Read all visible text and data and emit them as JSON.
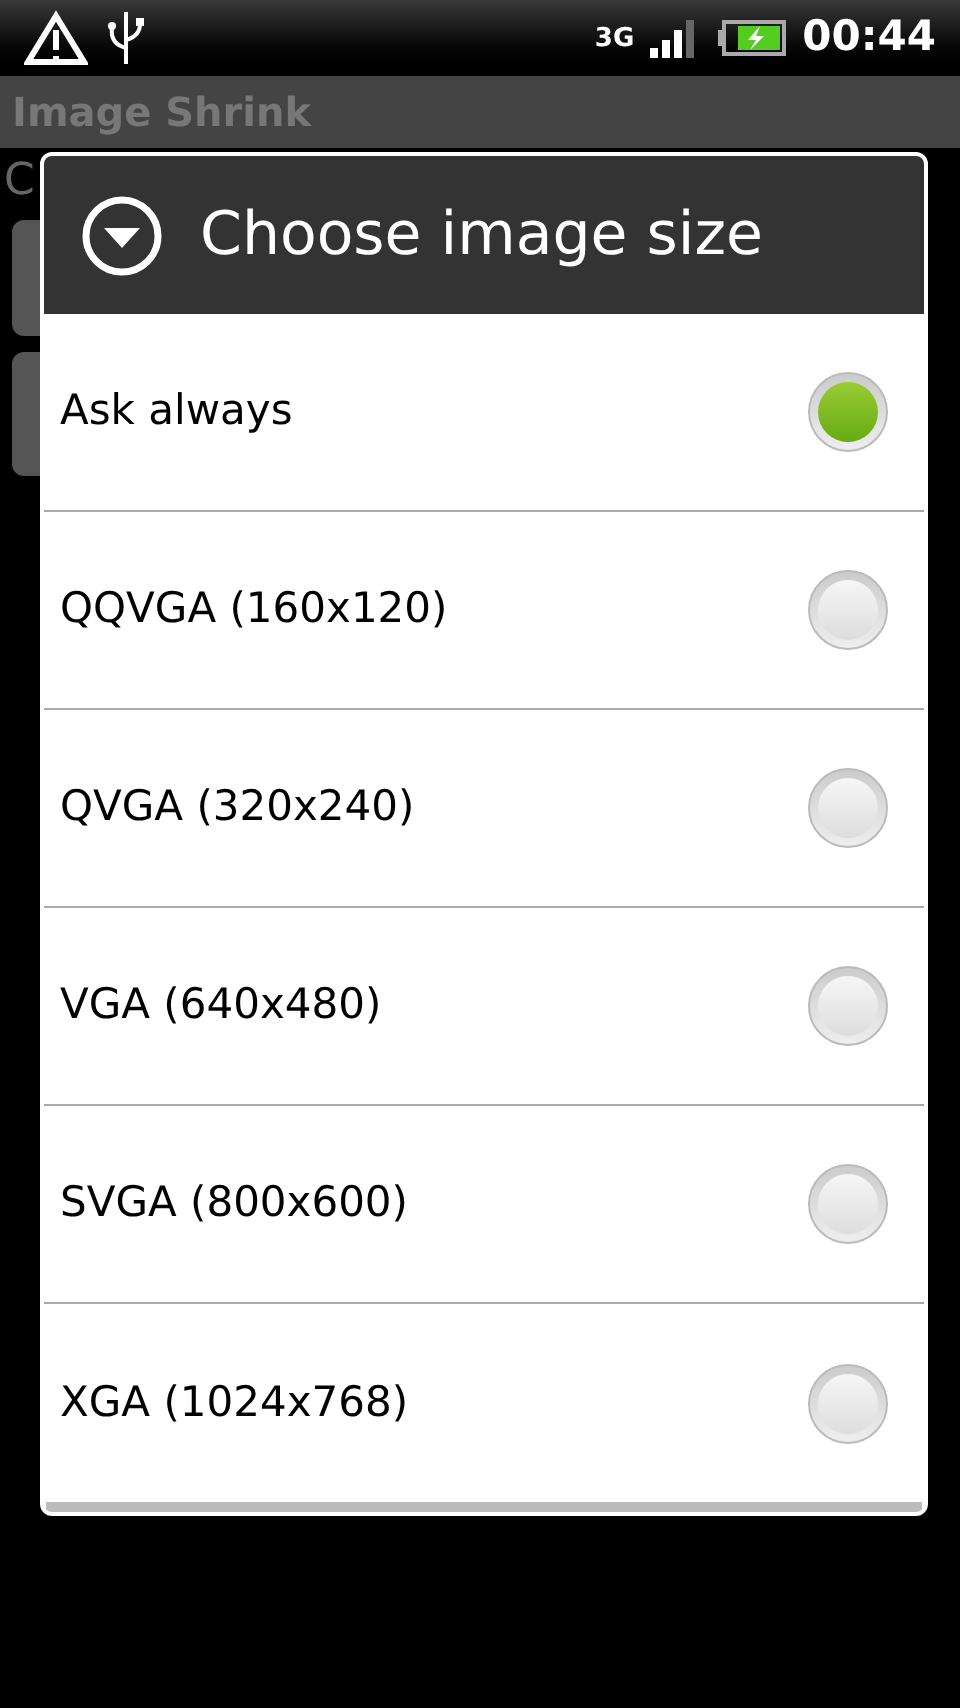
{
  "status_bar": {
    "network": "3G",
    "time": "00:44"
  },
  "app": {
    "title": "Image Shrink",
    "partial_text": "C"
  },
  "dialog": {
    "title": "Choose image size",
    "options": [
      {
        "label": "Ask always",
        "selected": true
      },
      {
        "label": "QQVGA (160x120)",
        "selected": false
      },
      {
        "label": "QVGA (320x240)",
        "selected": false
      },
      {
        "label": "VGA (640x480)",
        "selected": false
      },
      {
        "label": "SVGA (800x600)",
        "selected": false
      },
      {
        "label": "XGA (1024x768)",
        "selected": false
      }
    ]
  }
}
